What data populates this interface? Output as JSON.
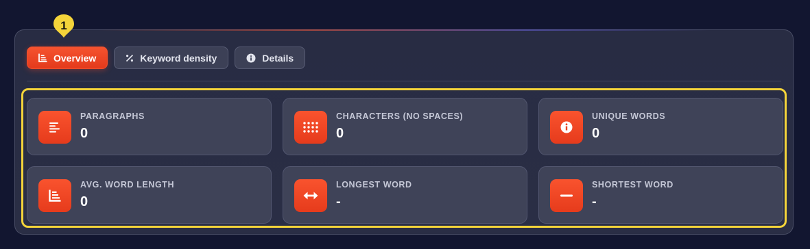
{
  "tabs": [
    {
      "label": "Overview",
      "icon": "bar-chart-icon",
      "active": true
    },
    {
      "label": "Keyword density",
      "icon": "percent-icon",
      "active": false
    },
    {
      "label": "Details",
      "icon": "info-icon",
      "active": false
    }
  ],
  "marker": {
    "number": "1",
    "color": "#f4d43a"
  },
  "stats": [
    {
      "label": "PARAGRAPHS",
      "value": "0",
      "icon": "align-left-icon"
    },
    {
      "label": "CHARACTERS (NO SPACES)",
      "value": "0",
      "icon": "grid-dots-icon"
    },
    {
      "label": "UNIQUE WORDS",
      "value": "0",
      "icon": "info-icon"
    },
    {
      "label": "AVG. WORD LENGTH",
      "value": "0",
      "icon": "bar-chart-icon"
    },
    {
      "label": "LONGEST WORD",
      "value": "-",
      "icon": "arrows-horizontal-icon"
    },
    {
      "label": "SHORTEST WORD",
      "value": "-",
      "icon": "minus-icon"
    }
  ],
  "colors": {
    "accent": "#f04a26",
    "highlight": "#f4d43a",
    "background": "#121630"
  }
}
